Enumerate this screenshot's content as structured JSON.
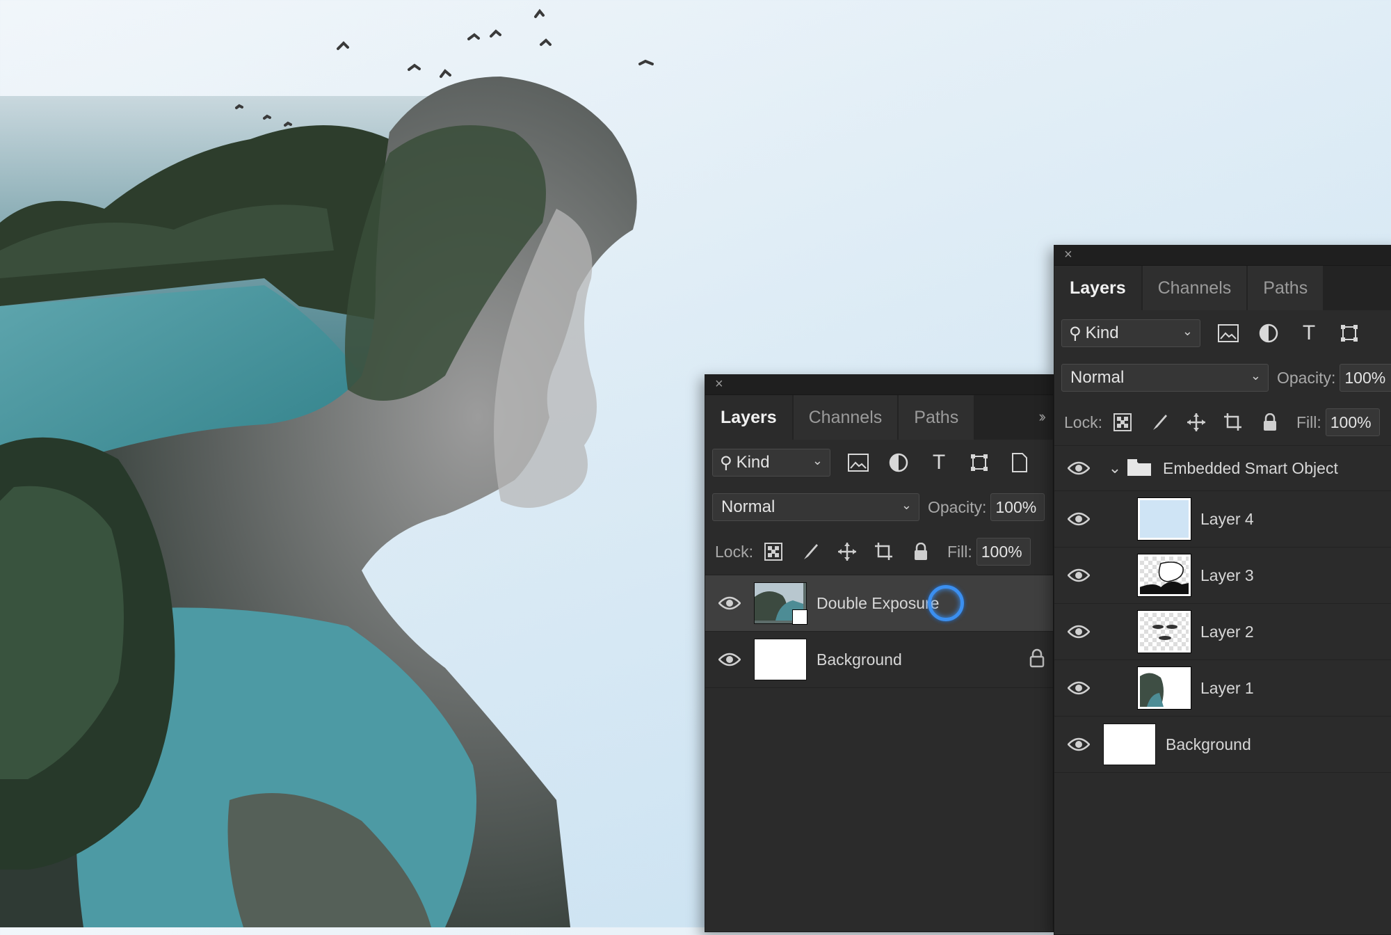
{
  "panel_left": {
    "tabs": [
      {
        "label": "Layers",
        "active": true
      },
      {
        "label": "Channels",
        "active": false
      },
      {
        "label": "Paths",
        "active": false
      }
    ],
    "filter": {
      "label": "Kind"
    },
    "blend_mode": "Normal",
    "opacity_label": "Opacity:",
    "opacity_value": "100%",
    "lock_label": "Lock:",
    "fill_label": "Fill:",
    "fill_value": "100%",
    "layers": [
      {
        "name": "Double Exposure",
        "selected": true,
        "type": "smart-object"
      },
      {
        "name": "Background",
        "selected": false,
        "locked": true
      }
    ]
  },
  "panel_right": {
    "tabs": [
      {
        "label": "Layers",
        "active": true
      },
      {
        "label": "Channels",
        "active": false
      },
      {
        "label": "Paths",
        "active": false
      }
    ],
    "filter": {
      "label": "Kind"
    },
    "blend_mode": "Normal",
    "opacity_label": "Opacity:",
    "opacity_value": "100%",
    "lock_label": "Lock:",
    "fill_label": "Fill:",
    "fill_value": "100%",
    "group": {
      "name": "Embedded Smart Object",
      "expanded": true
    },
    "layers": [
      {
        "name": "Layer 4"
      },
      {
        "name": "Layer 3"
      },
      {
        "name": "Layer 2"
      },
      {
        "name": "Layer 1"
      },
      {
        "name": "Background",
        "locked": true
      }
    ]
  },
  "colors": {
    "panel_bg": "#2b2b2b",
    "selected_row": "#3f3f3f",
    "accent_cursor": "#3b8ff0",
    "sky_light": "#f1f6fa",
    "sky_blue": "#c7e0f1"
  }
}
